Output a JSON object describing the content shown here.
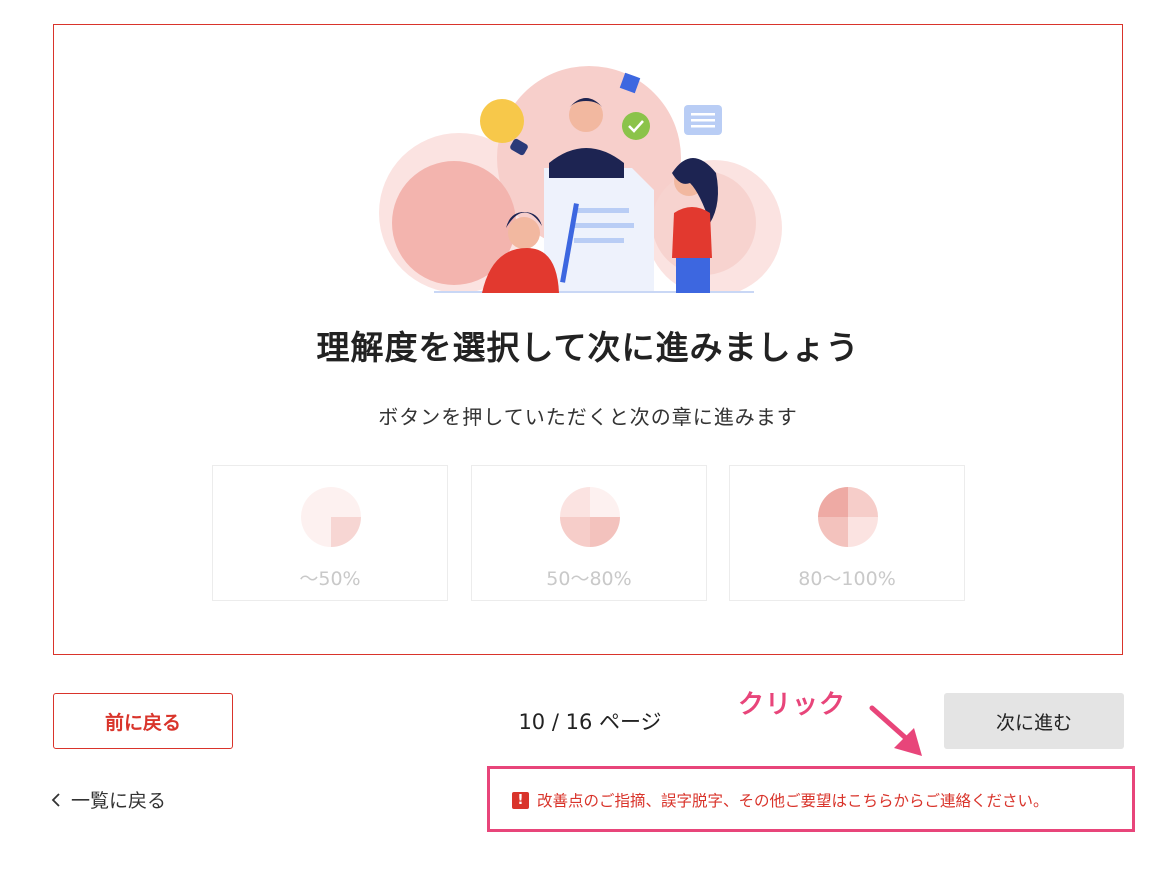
{
  "card": {
    "title": "理解度を選択して次に進みましょう",
    "subtitle": "ボタンを押していただくと次の章に進みます"
  },
  "options": [
    {
      "label": "〜50%",
      "level": 1
    },
    {
      "label": "50〜80%",
      "level": 2
    },
    {
      "label": "80〜100%",
      "level": 3
    }
  ],
  "nav": {
    "prev_label": "前に戻る",
    "page_indicator": "10 / 16 ページ",
    "next_label": "次に進む",
    "back_to_list": "一覧に戻る"
  },
  "annotation": {
    "click_label": "クリック"
  },
  "feedback": {
    "icon": "exclamation-icon",
    "text": "改善点のご指摘、誤字脱字、その他ご要望はこちらからご連絡ください。"
  },
  "colors": {
    "accent": "#d9342b",
    "annotation": "#e8457a",
    "next_button_bg": "#e4e4e4"
  }
}
